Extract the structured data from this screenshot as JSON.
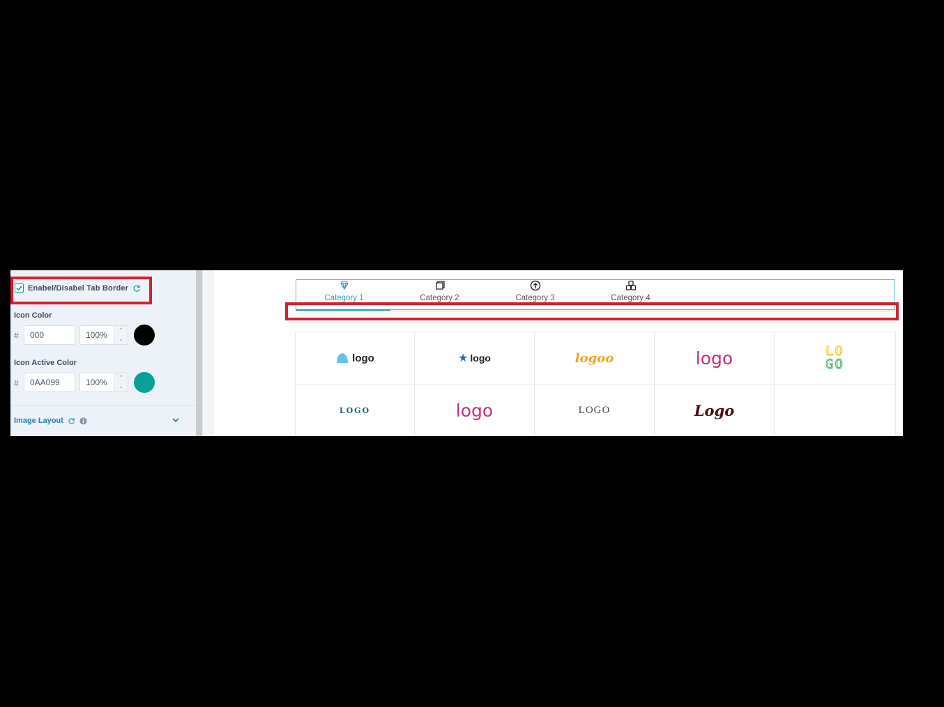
{
  "panel": {
    "checkbox_label": "Enabel/Disabel Tab Border",
    "icon_color": {
      "label": "Icon Color",
      "hash": "#",
      "value": "000",
      "opacity": "100%",
      "swatch": "#000000"
    },
    "icon_active_color": {
      "label": "Icon Active Color",
      "hash": "#",
      "value": "0AA099",
      "opacity": "100%",
      "swatch": "#0AA099"
    },
    "image_layout_label": "Image Layout"
  },
  "tabs": [
    {
      "label": "Category 1",
      "icon": "diamond-icon",
      "active": true
    },
    {
      "label": "Category 2",
      "icon": "copy-icon",
      "active": false
    },
    {
      "label": "Category 3",
      "icon": "arrow-up-circle-icon",
      "active": false
    },
    {
      "label": "Category 4",
      "icon": "cubes-icon",
      "active": false
    }
  ],
  "logos": {
    "r1c1": "logo",
    "r1c2": "logo",
    "r1c3": "logoo",
    "r1c4": "logo",
    "r1c5a": "LO",
    "r1c5b": "GO",
    "r2c1": "LOGO",
    "r2c2": "logo",
    "r2c3": "LOGO",
    "r2c4": "Logo"
  },
  "colors": {
    "accent": "#0AA099",
    "tab_active": "#2AA3B8",
    "highlight": "#D4202E"
  }
}
